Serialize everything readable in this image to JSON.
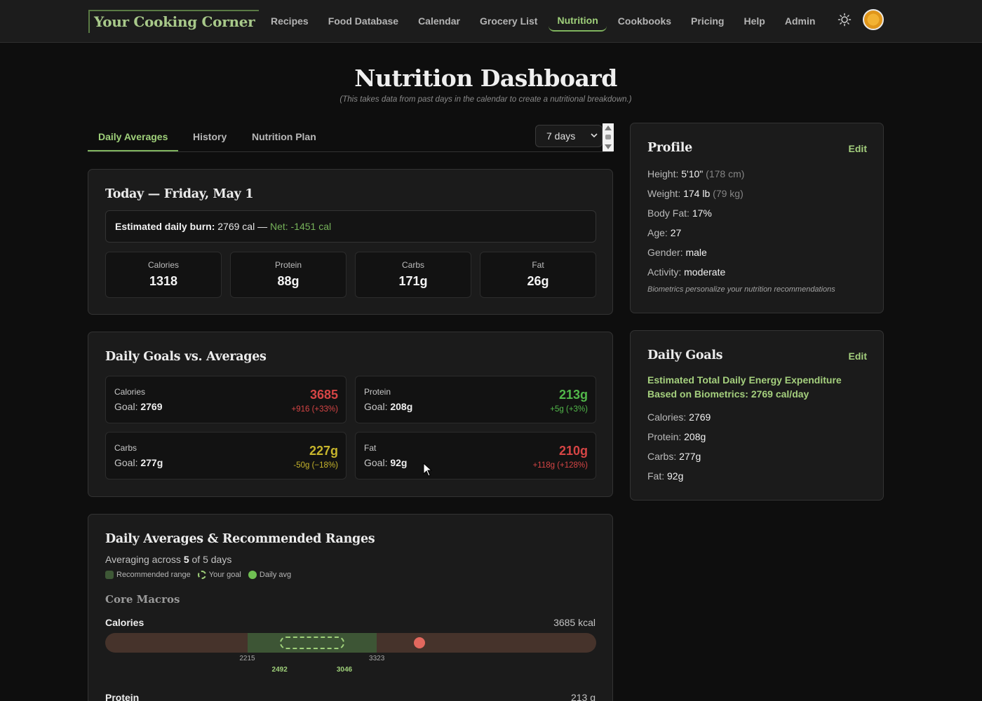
{
  "app": {
    "logo": "Your Cooking Corner"
  },
  "nav": {
    "items": [
      {
        "label": "Recipes",
        "active": false
      },
      {
        "label": "Food Database",
        "active": false
      },
      {
        "label": "Calendar",
        "active": false
      },
      {
        "label": "Grocery List",
        "active": false
      },
      {
        "label": "Nutrition",
        "active": true
      },
      {
        "label": "Cookbooks",
        "active": false
      },
      {
        "label": "Pricing",
        "active": false
      },
      {
        "label": "Help",
        "active": false
      },
      {
        "label": "Admin",
        "active": false
      }
    ],
    "theme_icon": "sun-icon",
    "avatar_icon": "user-avatar"
  },
  "header": {
    "title": "Nutrition Dashboard",
    "subtitle": "(This takes data from past days in the calendar to create a nutritional breakdown.)"
  },
  "tabs": {
    "items": [
      {
        "label": "Daily Averages",
        "active": true
      },
      {
        "label": "History",
        "active": false
      },
      {
        "label": "Nutrition Plan",
        "active": false
      }
    ],
    "range_select": "7 days"
  },
  "today": {
    "title": "Today — Friday, May 1",
    "burn_label": "Estimated daily burn:",
    "burn_value": "2769 cal —",
    "net": "Net: -1451 cal",
    "stats": [
      {
        "label": "Calories",
        "value": "1318"
      },
      {
        "label": "Protein",
        "value": "88g"
      },
      {
        "label": "Carbs",
        "value": "171g"
      },
      {
        "label": "Fat",
        "value": "26g"
      }
    ]
  },
  "goals": {
    "title": "Daily Goals vs. Averages",
    "goal_prefix": "Goal:",
    "items": [
      {
        "name": "Calories",
        "goal": "2769",
        "value": "3685",
        "diff": "+916 (+33%)",
        "status": "red"
      },
      {
        "name": "Protein",
        "goal": "208g",
        "value": "213g",
        "diff": "+5g (+3%)",
        "status": "green"
      },
      {
        "name": "Carbs",
        "goal": "277g",
        "value": "227g",
        "diff": "-50g (−18%)",
        "status": "yellow"
      },
      {
        "name": "Fat",
        "goal": "92g",
        "value": "210g",
        "diff": "+118g (+128%)",
        "status": "red"
      }
    ]
  },
  "ranges": {
    "title": "Daily Averages & Recommended Ranges",
    "averaging_prefix": "Averaging across",
    "days_used": "5",
    "averaging_suffix": "of 5 days",
    "legend": {
      "range": "Recommended range",
      "goal": "Your goal",
      "avg": "Daily avg"
    },
    "section": "Core Macros",
    "metrics": [
      {
        "name": "Calories",
        "value_text": "3685 kcal",
        "scale_min": 1000,
        "scale_max": 5200,
        "rec_min": 2215,
        "rec_max": 3323,
        "goal_min": 2492,
        "goal_max": 3046,
        "avg": 3685,
        "ticks": {
          "rec_min": "2215",
          "rec_max": "3323",
          "goal_min": "2492",
          "goal_max": "3046"
        }
      },
      {
        "name": "Protein",
        "value_text": "213 g"
      }
    ]
  },
  "profile": {
    "title": "Profile",
    "edit": "Edit",
    "rows": [
      {
        "label": "Height:",
        "value": "5'10\"",
        "extra": "(178 cm)"
      },
      {
        "label": "Weight:",
        "value": "174 lb",
        "extra": "(79 kg)"
      },
      {
        "label": "Body Fat:",
        "value": "17%",
        "extra": ""
      },
      {
        "label": "Age:",
        "value": "27",
        "extra": ""
      },
      {
        "label": "Gender:",
        "value": "male",
        "extra": ""
      },
      {
        "label": "Activity:",
        "value": "moderate",
        "extra": ""
      }
    ],
    "note": "Biometrics personalize your nutrition recommendations"
  },
  "daily_goals": {
    "title": "Daily Goals",
    "edit": "Edit",
    "tdee": "Estimated Total Daily Energy Expenditure Based on Biometrics: 2769 cal/day",
    "rows": [
      {
        "label": "Calories:",
        "value": "2769"
      },
      {
        "label": "Protein:",
        "value": "208g"
      },
      {
        "label": "Carbs:",
        "value": "277g"
      },
      {
        "label": "Fat:",
        "value": "92g"
      }
    ]
  },
  "colors": {
    "accent": "#9fd07a",
    "over": "#d64545",
    "ok": "#52b84a",
    "under": "#c7b52c"
  }
}
